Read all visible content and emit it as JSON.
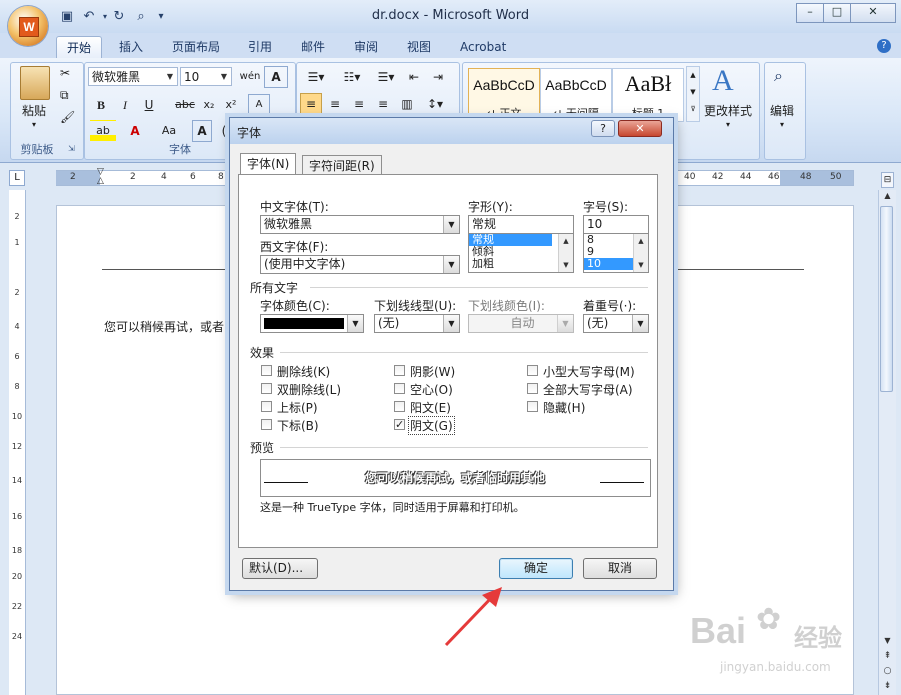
{
  "window": {
    "title": "dr.docx - Microsoft Word",
    "controls": [
      "–",
      "□",
      "✕"
    ]
  },
  "ribbon": {
    "tabs": [
      "开始",
      "插入",
      "页面布局",
      "引用",
      "邮件",
      "审阅",
      "视图",
      "Acrobat"
    ],
    "active_tab": "开始",
    "clipboard": {
      "label": "剪贴板",
      "paste": "粘贴"
    },
    "font": {
      "label": "字体",
      "name": "微软雅黑",
      "size": "10"
    },
    "styles": [
      {
        "sample": "AaBbCcD",
        "name": "↵ 正文"
      },
      {
        "sample": "AaBbCcD",
        "name": "↵ 无间隔"
      },
      {
        "sample": "AaBł",
        "name": "标题 1"
      }
    ],
    "change_styles": "更改样式",
    "edit": "编辑"
  },
  "ruler": {
    "h": [
      "2",
      "2",
      "4",
      "6",
      "8",
      "40",
      "42",
      "44",
      "46",
      "48",
      "50"
    ],
    "v": [
      "2",
      "1",
      "2",
      "4",
      "6",
      "8",
      "10",
      "12",
      "14",
      "16",
      "18",
      "20",
      "22",
      "24"
    ]
  },
  "document": {
    "text": "您可以稍候再试，或者"
  },
  "dialog": {
    "title": "字体",
    "help": "?",
    "close": "✕",
    "tabs": [
      "字体(N)",
      "字符间距(R)"
    ],
    "labels": {
      "cn_font": "中文字体(T):",
      "west_font": "西文字体(F):",
      "style": "字形(Y):",
      "size": "字号(S):",
      "all_text": "所有文字",
      "font_color": "字体颜色(C):",
      "underline": "下划线线型(U):",
      "underline_color": "下划线颜色(I):",
      "emphasis": "着重号(·):",
      "effects": "效果",
      "preview": "预览"
    },
    "values": {
      "cn_font": "微软雅黑",
      "west_font": "(使用中文字体)",
      "style": "常规",
      "size": "10",
      "underline": "(无)",
      "underline_color": "自动",
      "emphasis": "(无)",
      "font_color": "#000000"
    },
    "style_list": [
      "常规",
      "倾斜",
      "加粗"
    ],
    "style_selected": 0,
    "size_list": [
      "8",
      "9",
      "10"
    ],
    "size_selected": 2,
    "effects": [
      {
        "label": "删除线(K)",
        "checked": false
      },
      {
        "label": "双删除线(L)",
        "checked": false
      },
      {
        "label": "上标(P)",
        "checked": false
      },
      {
        "label": "下标(B)",
        "checked": false
      },
      {
        "label": "阴影(W)",
        "checked": false
      },
      {
        "label": "空心(O)",
        "checked": false
      },
      {
        "label": "阳文(E)",
        "checked": false
      },
      {
        "label": "阴文(G)",
        "checked": true
      },
      {
        "label": "小型大写字母(M)",
        "checked": false
      },
      {
        "label": "全部大写字母(A)",
        "checked": false
      },
      {
        "label": "隐藏(H)",
        "checked": false
      }
    ],
    "preview_text": "您可以稍候再试，或者临时用其他",
    "truetype_note": "这是一种 TrueType 字体，同时适用于屏幕和打印机。",
    "buttons": {
      "default": "默认(D)...",
      "ok": "确定",
      "cancel": "取消"
    }
  },
  "watermark": {
    "brand": "Bai",
    "brand2": "经验",
    "url": "jingyan.baidu.com"
  },
  "colors": {
    "accent": "#3399ff",
    "arrow": "#e53a3a"
  }
}
